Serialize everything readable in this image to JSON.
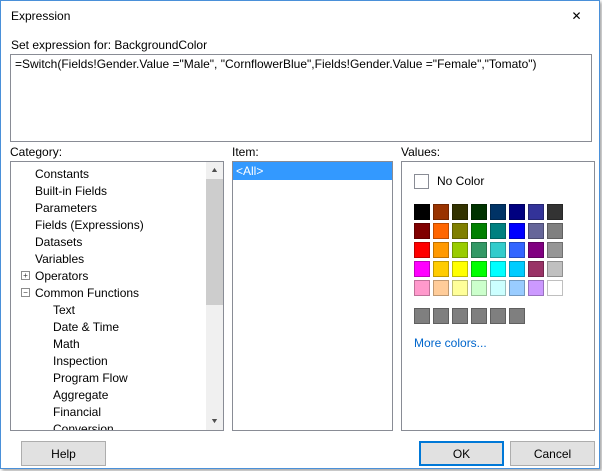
{
  "window": {
    "title": "Expression",
    "close_glyph": "✕"
  },
  "header": {
    "label": "Set expression for: BackgroundColor"
  },
  "expression": {
    "value": "=Switch(Fields!Gender.Value =\"Male\", \"CornflowerBlue\",Fields!Gender.Value =\"Female\",\"Tomato\")"
  },
  "category": {
    "label": "Category:",
    "items": [
      {
        "label": "Constants",
        "level": 0,
        "expander": ""
      },
      {
        "label": "Built-in Fields",
        "level": 0,
        "expander": ""
      },
      {
        "label": "Parameters",
        "level": 0,
        "expander": ""
      },
      {
        "label": "Fields (Expressions)",
        "level": 0,
        "expander": ""
      },
      {
        "label": "Datasets",
        "level": 0,
        "expander": ""
      },
      {
        "label": "Variables",
        "level": 0,
        "expander": ""
      },
      {
        "label": "Operators",
        "level": 0,
        "expander": "+"
      },
      {
        "label": "Common Functions",
        "level": 0,
        "expander": "−"
      },
      {
        "label": "Text",
        "level": 1,
        "expander": ""
      },
      {
        "label": "Date & Time",
        "level": 1,
        "expander": ""
      },
      {
        "label": "Math",
        "level": 1,
        "expander": ""
      },
      {
        "label": "Inspection",
        "level": 1,
        "expander": ""
      },
      {
        "label": "Program Flow",
        "level": 1,
        "expander": ""
      },
      {
        "label": "Aggregate",
        "level": 1,
        "expander": ""
      },
      {
        "label": "Financial",
        "level": 1,
        "expander": ""
      },
      {
        "label": "Conversion",
        "level": 1,
        "expander": ""
      }
    ],
    "scrollbar": {
      "up_glyph": "▲",
      "down_glyph": "▼"
    }
  },
  "item": {
    "label": "Item:",
    "items": [
      {
        "label": "<All>",
        "selected": true
      }
    ]
  },
  "values": {
    "label": "Values:",
    "no_color_label": "No Color",
    "more_colors_label": "More colors...",
    "palette": [
      [
        "#000000",
        "#993300",
        "#333300",
        "#003300",
        "#003366",
        "#000080",
        "#333399",
        "#333333"
      ],
      [
        "#800000",
        "#FF6600",
        "#808000",
        "#008000",
        "#008080",
        "#0000FF",
        "#666699",
        "#808080"
      ],
      [
        "#FF0000",
        "#FF9900",
        "#99CC00",
        "#339966",
        "#33CCCC",
        "#3366FF",
        "#800080",
        "#969696"
      ],
      [
        "#FF00FF",
        "#FFCC00",
        "#FFFF00",
        "#00FF00",
        "#00FFFF",
        "#00CCFF",
        "#993366",
        "#C0C0C0"
      ],
      [
        "#FF99CC",
        "#FFCC99",
        "#FFFF99",
        "#CCFFCC",
        "#CCFFFF",
        "#99CCFF",
        "#CC99FF",
        "#FFFFFF"
      ]
    ],
    "grays": [
      "#7F7F7F",
      "#7F7F7F",
      "#7F7F7F",
      "#7F7F7F",
      "#7F7F7F",
      "#7F7F7F"
    ]
  },
  "buttons": {
    "help": "Help",
    "ok": "OK",
    "cancel": "Cancel"
  },
  "colors": {
    "accent": "#0078d7",
    "dialog_border": "#4a90d9",
    "selection": "#3399ff",
    "link": "#0066cc"
  }
}
